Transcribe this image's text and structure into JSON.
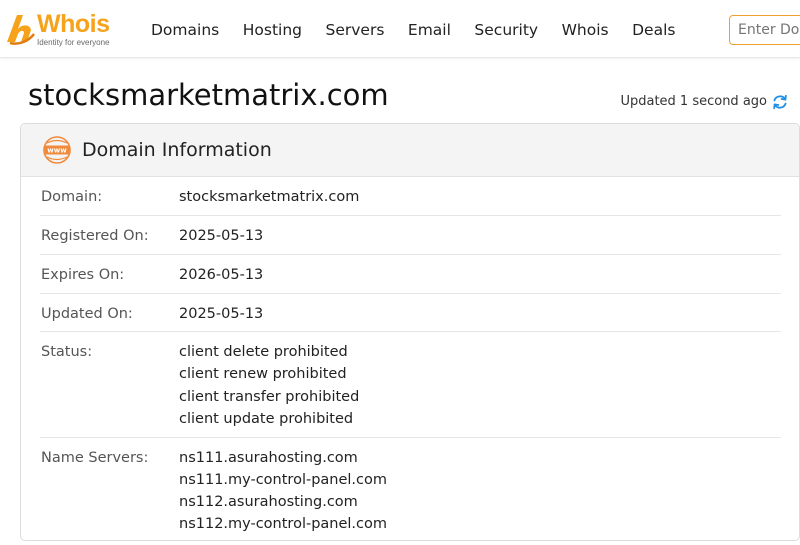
{
  "header": {
    "logo": {
      "word": "Whois",
      "tagline": "Identity for everyone"
    },
    "nav": [
      "Domains",
      "Hosting",
      "Servers",
      "Email",
      "Security",
      "Whois",
      "Deals"
    ],
    "search": {
      "placeholder": "Enter Domain",
      "value": ""
    },
    "colors": {
      "brand": "#f7a21b",
      "accent": "#1e8fe6"
    }
  },
  "page": {
    "title": "stocksmarketmatrix.com",
    "updated_text": "Updated 1 second ago",
    "updated_icon": "refresh-icon"
  },
  "card": {
    "icon": "www-icon",
    "title": "Domain Information",
    "rows": [
      {
        "label": "Domain:",
        "values": [
          "stocksmarketmatrix.com"
        ]
      },
      {
        "label": "Registered On:",
        "values": [
          "2025-05-13"
        ]
      },
      {
        "label": "Expires On:",
        "values": [
          "2026-05-13"
        ]
      },
      {
        "label": "Updated On:",
        "values": [
          "2025-05-13"
        ]
      },
      {
        "label": "Status:",
        "values": [
          "client delete prohibited",
          "client renew prohibited",
          "client transfer prohibited",
          "client update prohibited"
        ]
      },
      {
        "label": "Name Servers:",
        "values": [
          "ns111.asurahosting.com",
          "ns111.my-control-panel.com",
          "ns112.asurahosting.com",
          "ns112.my-control-panel.com"
        ]
      }
    ]
  }
}
